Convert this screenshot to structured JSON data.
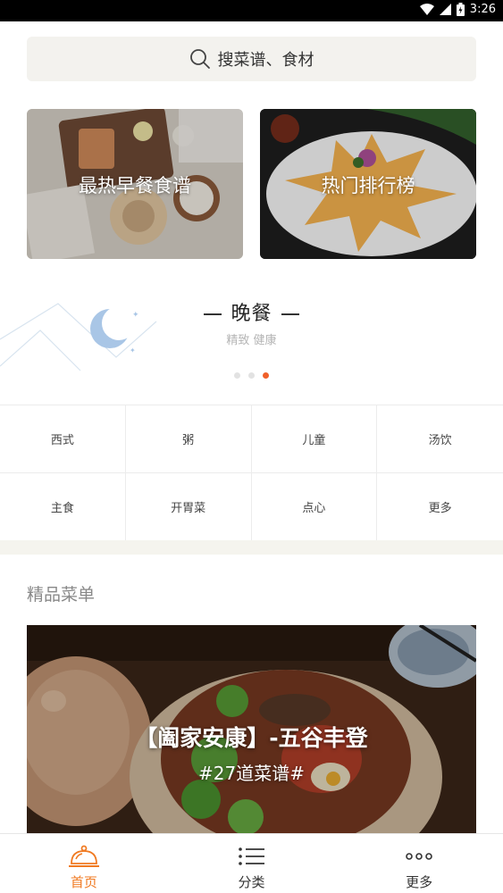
{
  "status_bar": {
    "time": "3:26"
  },
  "search": {
    "placeholder": "搜菜谱、食材",
    "icon": "search-icon"
  },
  "feature_cards": [
    {
      "label": "最热早餐食谱"
    },
    {
      "label": "热门排行榜"
    }
  ],
  "meal_banner": {
    "title": "晚餐",
    "subtitle": "精致 健康",
    "icon": "moon-icon",
    "page_count": 3,
    "active_page": 3
  },
  "categories": [
    "西式",
    "粥",
    "儿童",
    "汤饮",
    "主食",
    "开胃菜",
    "点心",
    "更多"
  ],
  "section": {
    "title": "精品菜单"
  },
  "featured_menu": {
    "title": "【阖家安康】-五谷丰登",
    "subtitle": "#27道菜谱#"
  },
  "tabs": [
    {
      "label": "首页",
      "icon": "home-cloche-icon",
      "active": true
    },
    {
      "label": "分类",
      "icon": "list-icon",
      "active": false
    },
    {
      "label": "更多",
      "icon": "more-dots-icon",
      "active": false
    }
  ],
  "colors": {
    "accent": "#f0602a",
    "tab_active": "#f07a22",
    "search_bg": "#f3f2ee"
  }
}
